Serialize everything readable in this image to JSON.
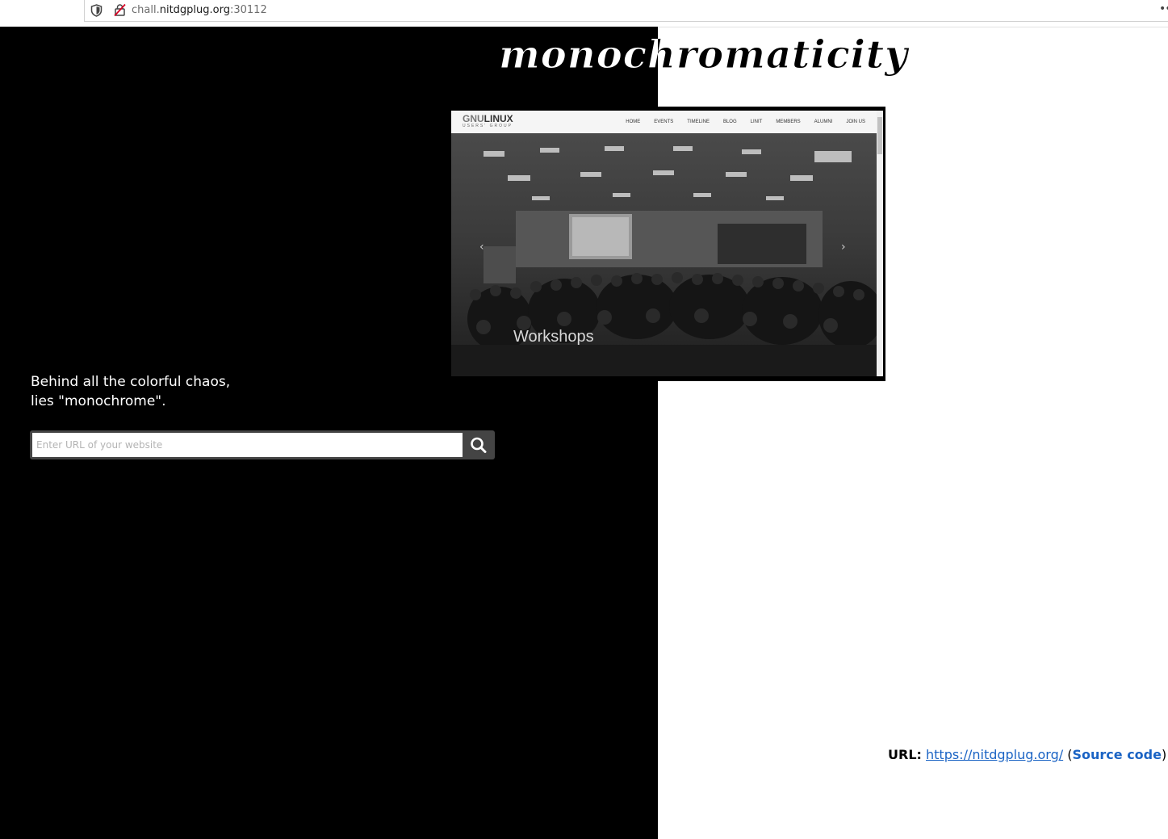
{
  "browser": {
    "url_prefix": "chall.",
    "url_host": "nitdgplug.org",
    "url_port": ":30112"
  },
  "page": {
    "title": "monochromaticity",
    "tagline_line1": "Behind all the colorful chaos,",
    "tagline_line2": "lies \"monochrome\"."
  },
  "search": {
    "placeholder": "Enter URL of your website",
    "value": ""
  },
  "preview": {
    "logo_gnu": "GNU",
    "logo_linux": "LINUX",
    "logo_sub": "USERS' GROUP",
    "menu": [
      "HOME",
      "EVENTS",
      "TIMELINE",
      "BLOG",
      "LINIT",
      "MEMBERS",
      "ALUMNI",
      "JOIN US"
    ],
    "caption": "Workshops",
    "prev_glyph": "‹",
    "next_glyph": "›"
  },
  "footer": {
    "label": "URL:",
    "url": "https://nitdgplug.org/",
    "open_paren": "(",
    "source_label": "Source code",
    "close_paren": ")"
  },
  "colors": {
    "left_bg": "#000000",
    "right_bg": "#ffffff",
    "link": "#1a63c4",
    "search_button": "#444444"
  },
  "icons": {
    "shield": "shield-icon",
    "lock": "insecure-lock-icon",
    "search": "search-icon",
    "menu": "overflow-menu-icon"
  }
}
